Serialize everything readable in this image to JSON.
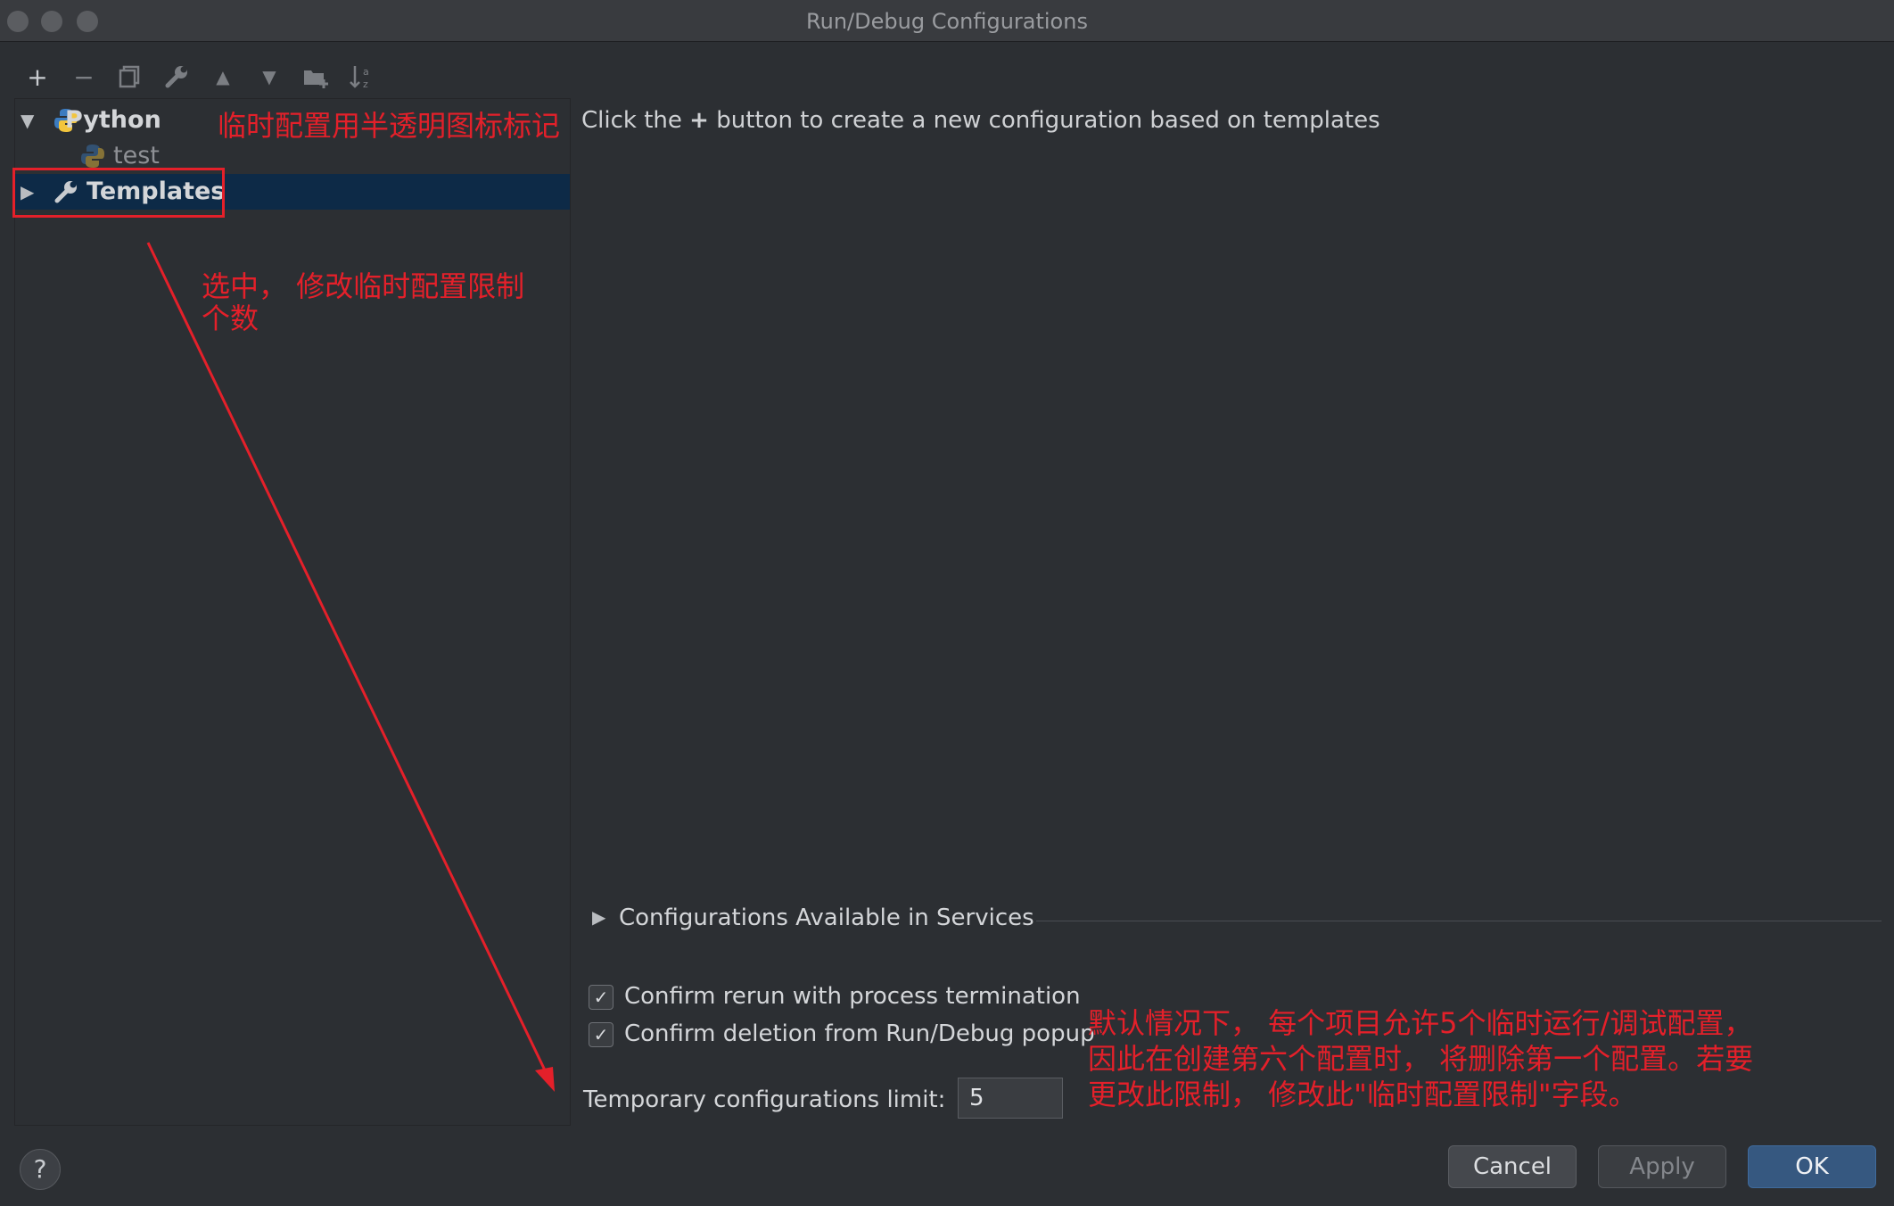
{
  "window": {
    "title": "Run/Debug Configurations"
  },
  "toolbar": {
    "buttons": [
      {
        "name": "add-icon",
        "glyph": "+",
        "enabled": true
      },
      {
        "name": "remove-icon",
        "glyph": "−",
        "enabled": false
      },
      {
        "name": "copy-icon",
        "glyph": "⧉",
        "enabled": false
      },
      {
        "name": "wrench-icon",
        "glyph": "🔧",
        "enabled": false
      },
      {
        "name": "move-up-icon",
        "glyph": "▲",
        "enabled": false
      },
      {
        "name": "move-down-icon",
        "glyph": "▼",
        "enabled": false
      },
      {
        "name": "new-folder-icon",
        "glyph": "📁",
        "enabled": false
      },
      {
        "name": "sort-icon",
        "glyph": "⇅",
        "enabled": false
      }
    ]
  },
  "tree": {
    "python": {
      "label": "Python",
      "icon": "python-icon",
      "expanded": true
    },
    "test": {
      "label": "test",
      "icon": "python-icon-translucent"
    },
    "templates": {
      "label": "Templates",
      "icon": "wrench-icon",
      "expanded": false
    }
  },
  "main": {
    "hint_before": "Click the",
    "hint_plus": "+",
    "hint_after": "button to create a new configuration based on templates",
    "services_label": "Configurations Available in Services",
    "confirm_rerun": {
      "label": "Confirm rerun with process termination",
      "checked": true
    },
    "confirm_deletion": {
      "label": "Confirm deletion from Run/Debug popup",
      "checked": true
    },
    "limit_label": "Temporary configurations limit:",
    "limit_value": "5"
  },
  "buttons": {
    "help": "?",
    "cancel": "Cancel",
    "apply": "Apply",
    "ok": "OK"
  },
  "annotations": {
    "translucent_note": "临时配置用半透明图标标记",
    "select_note_line1": "选中， 修改临时配置限制",
    "select_note_line2": "个数",
    "default_note_line1": "默认情况下， 每个项目允许5个临时运行/调试配置，",
    "default_note_line2": "因此在创建第六个配置时， 将删除第一个配置。若要",
    "default_note_line3": "更改此限制， 修改此\"临时配置限制\"字段。",
    "color": "#e4202a"
  }
}
